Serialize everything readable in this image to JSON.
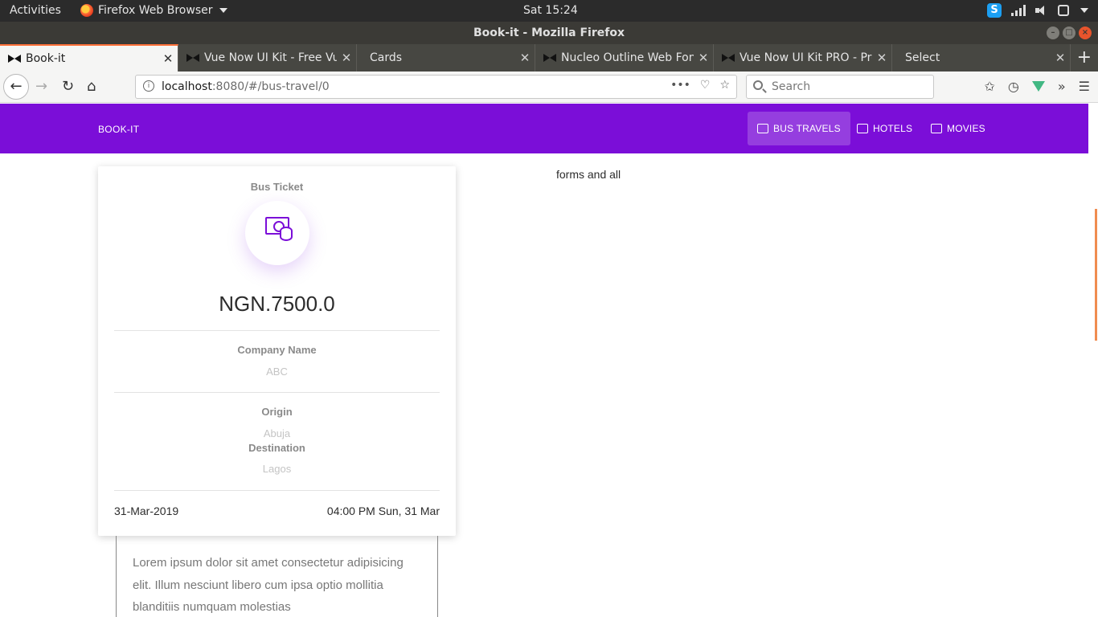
{
  "system_bar": {
    "activities": "Activities",
    "app_menu": "Firefox Web Browser",
    "clock": "Sat 15:24"
  },
  "window": {
    "title": "Book-it - Mozilla Firefox"
  },
  "tabs": [
    {
      "title": "Book-it",
      "active": true
    },
    {
      "title": "Vue Now UI Kit - Free Vue",
      "active": false
    },
    {
      "title": "Cards",
      "active": false
    },
    {
      "title": "Nucleo Outline Web Font",
      "active": false
    },
    {
      "title": "Vue Now UI Kit PRO - Pre",
      "active": false
    },
    {
      "title": "Select",
      "active": false
    }
  ],
  "url": {
    "host": "localhost",
    "rest": ":8080/#/bus-travel/0"
  },
  "search": {
    "placeholder": "Search"
  },
  "page_nav": {
    "brand": "BOOK-IT",
    "items": [
      {
        "label": "BUS TRAVELS",
        "active": true,
        "icon": "bus-icon"
      },
      {
        "label": "HOTELS",
        "active": false,
        "icon": "camera-icon"
      },
      {
        "label": "MOVIES",
        "active": false,
        "icon": "monitor-icon"
      }
    ],
    "accent": "#7b0ed8"
  },
  "ticket": {
    "category": "Bus Ticket",
    "icon": "money-coins-icon",
    "price": "NGN.7500.0",
    "company_label": "Company Name",
    "company_value": "ABC",
    "origin_label": "Origin",
    "origin_value": "Abuja",
    "destination_label": "Destination",
    "destination_value": "Lagos",
    "date": "31-Mar-2019",
    "time": "04:00 PM Sun, 31 Mar"
  },
  "below_text": "Lorem ipsum dolor sit amet consectetur adipisicing elit. Illum nesciunt libero cum ipsa optio mollitia blanditiis numquam molestias",
  "side_note": "forms and all"
}
